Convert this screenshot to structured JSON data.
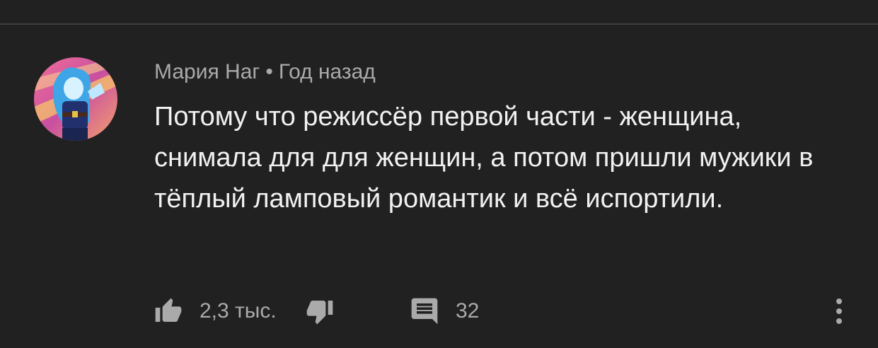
{
  "comment": {
    "author": "Мария Наг",
    "separator": "•",
    "time": "Год назад",
    "text": "Потому что режиссёр первой части - женщина, снимала для для женщин, а потом пришли мужики в тёплый ламповый романтик и всё испортили."
  },
  "actions": {
    "like_count": "2,3 тыс.",
    "reply_count": "32"
  },
  "icons": {
    "like": "thumbs-up-icon",
    "dislike": "thumbs-down-icon",
    "replies": "comment-icon",
    "menu": "more-vertical-icon"
  }
}
